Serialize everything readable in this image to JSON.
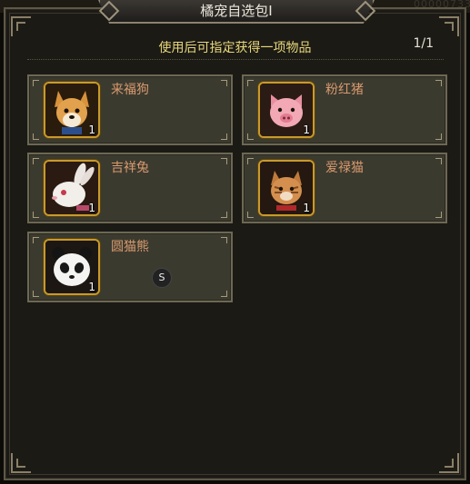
{
  "dialog": {
    "title": "橘宠自选包Ⅰ",
    "subtitle": "使用后可指定获得一项物品",
    "pager": "1/1",
    "background_digits": "00000733"
  },
  "items": [
    {
      "name": "来福狗",
      "icon": "shiba-dog-icon",
      "qty": "1"
    },
    {
      "name": "粉红猪",
      "icon": "pink-pig-icon",
      "qty": "1"
    },
    {
      "name": "吉祥兔",
      "icon": "white-rabbit-icon",
      "qty": "1"
    },
    {
      "name": "爱禄猫",
      "icon": "orange-cat-icon",
      "qty": "1"
    },
    {
      "name": "圆猫熊",
      "icon": "panda-icon",
      "qty": "1"
    }
  ],
  "cursor_badge": "S",
  "colors": {
    "panel": "#1b1a15",
    "card": "#3b3a2f",
    "slot_border": "#c89a2c",
    "name": "#d89a6e",
    "subtitle": "#e8d77a"
  }
}
